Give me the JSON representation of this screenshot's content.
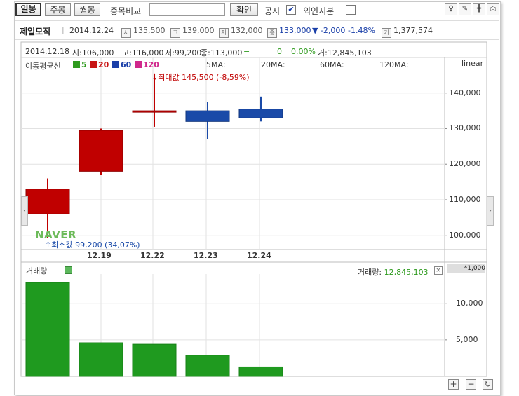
{
  "toolbar": {
    "tab_daily": "일봉",
    "tab_weekly": "주봉",
    "tab_monthly": "월봉",
    "compare_label": "종목비교",
    "compare_placeholder": "",
    "confirm_button": "확인",
    "disclosure_label": "공시",
    "disclosure_checked": true,
    "foreign_label": "외인지분",
    "foreign_checked": false
  },
  "stock": {
    "name": "제일모직",
    "date": "2014.12.24",
    "open_tag": "시",
    "open": "135,500",
    "high_tag": "고",
    "high": "139,000",
    "low_tag": "저",
    "low": "132,000",
    "close_tag": "종",
    "close": "133,000",
    "change": "▼ -2,000",
    "change_pct": "-1.48%",
    "volume_tag": "거",
    "volume": "1,377,574"
  },
  "info_line": {
    "date": "2014.12.18",
    "open": "시:106,000",
    "high": "고:116,000",
    "low": "저:99,200",
    "close": "종:113,000",
    "arrow": "≡",
    "change": "0",
    "change_pct": "0.00%",
    "volume": "거:12,845,103"
  },
  "ma_legend": {
    "label": "이동평균선",
    "items": [
      {
        "label": "5",
        "color": "#2e9a1e"
      },
      {
        "label": "20",
        "color": "#c81414"
      },
      {
        "label": "60",
        "color": "#1a3fa8"
      },
      {
        "label": "120",
        "color": "#d0288c"
      }
    ],
    "ma5": "5MA:",
    "ma20": "20MA:",
    "ma60": "60MA:",
    "ma120": "120MA:",
    "scale": "linear"
  },
  "annotations": {
    "max": "최대값 145,500 (-8,59%)",
    "min": "최소값 99,200 (34,07%)",
    "watermark": "NAVER"
  },
  "volume_panel": {
    "title": "거래량",
    "legend": "거래량:",
    "legend_value": "12,845,103",
    "unit": "*1,000",
    "close_symbol": "×"
  },
  "colors": {
    "up": "#c00000",
    "down": "#1a4aa8",
    "volume": "#1f9a1f"
  },
  "chart_data": {
    "type": "candlestick",
    "categories": [
      "12.18",
      "12.19",
      "12.22",
      "12.23",
      "12.24"
    ],
    "x_tick_labels": [
      "12.19",
      "12.22",
      "12.23",
      "12.24"
    ],
    "ohlc": [
      {
        "date": "12.18",
        "open": 106000,
        "high": 116000,
        "low": 99200,
        "close": 113000
      },
      {
        "date": "12.19",
        "open": 118000,
        "high": 130000,
        "low": 117000,
        "close": 129500
      },
      {
        "date": "12.22",
        "open": 135000,
        "high": 145500,
        "low": 130500,
        "close": 135000
      },
      {
        "date": "12.23",
        "open": 135000,
        "high": 137500,
        "low": 127000,
        "close": 132000
      },
      {
        "date": "12.24",
        "open": 135500,
        "high": 139000,
        "low": 132000,
        "close": 133000
      }
    ],
    "price_ticks": [
      "100,000",
      "110,000",
      "120,000",
      "130,000",
      "140,000"
    ],
    "price_tick_values": [
      100000,
      110000,
      120000,
      130000,
      140000
    ],
    "ylim": [
      96000,
      150000
    ],
    "volume_values": [
      12845,
      4600,
      4400,
      2900,
      1300
    ],
    "volume_ticks": [
      "5,000",
      "10,000"
    ],
    "volume_tick_values": [
      5000,
      10000
    ],
    "volume_ylim": [
      0,
      14000
    ]
  }
}
